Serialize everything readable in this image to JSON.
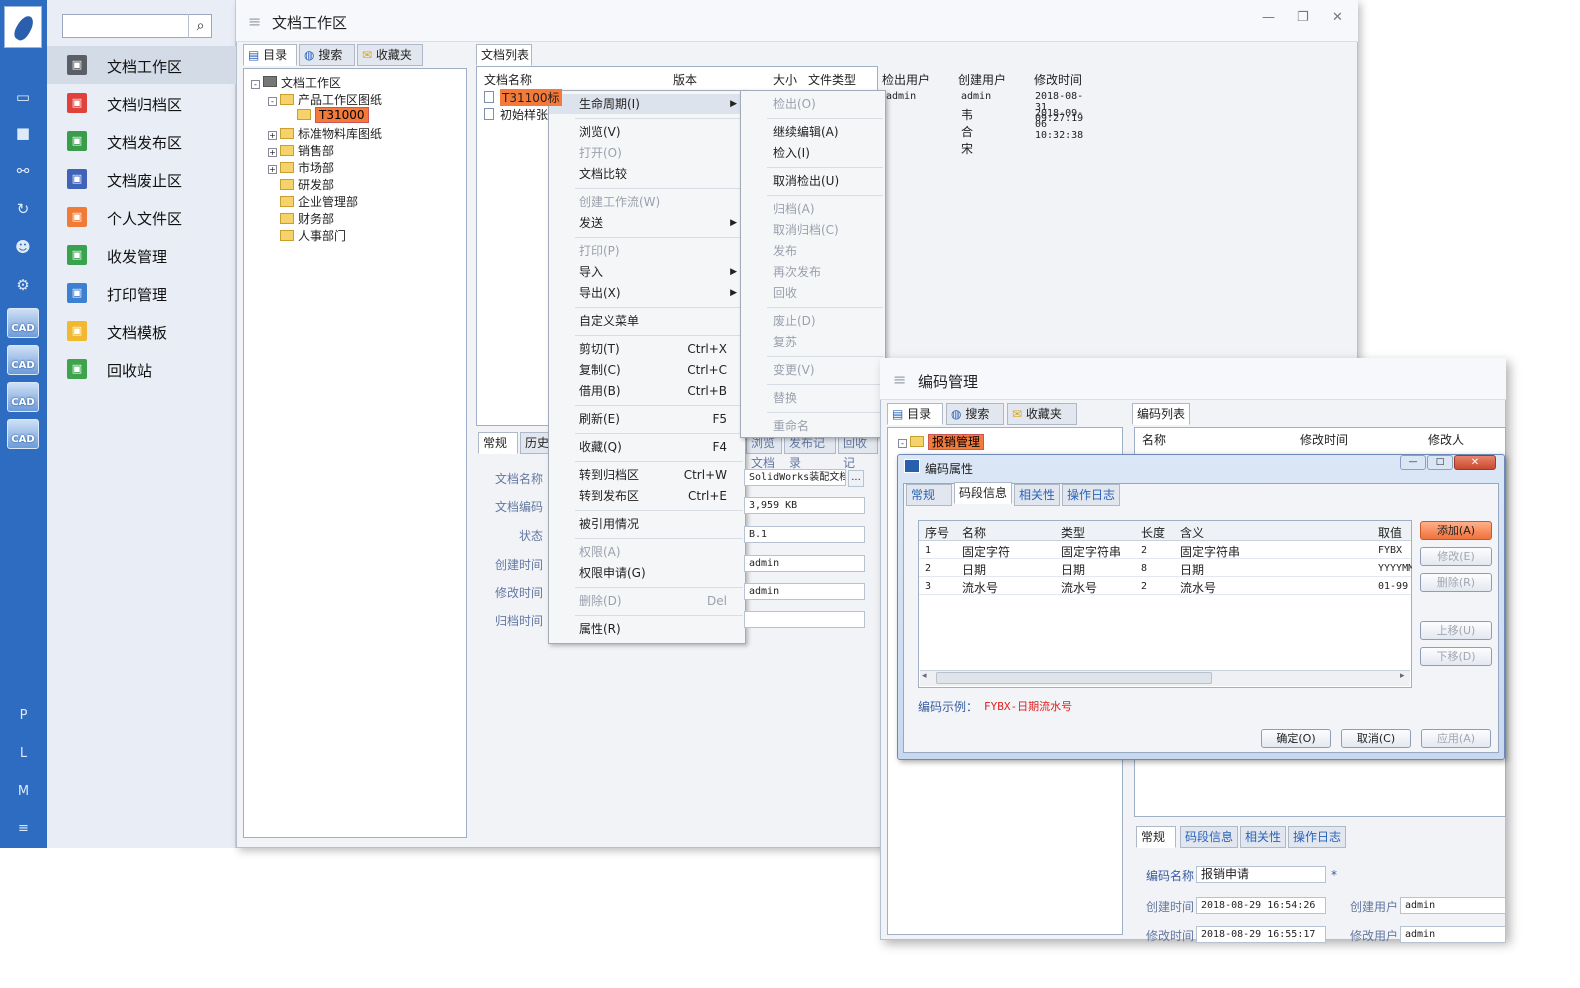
{
  "rail": {
    "letters": [
      "P",
      "L",
      "M",
      "≡"
    ],
    "cad_label": "CAD"
  },
  "nav": {
    "items": [
      {
        "label": "文档工作区",
        "color": "#5a5f66"
      },
      {
        "label": "文档归档区",
        "color": "#e0413a"
      },
      {
        "label": "文档发布区",
        "color": "#3a9d4a"
      },
      {
        "label": "文档废止区",
        "color": "#3f63b8"
      },
      {
        "label": "个人文件区",
        "color": "#f07b36"
      },
      {
        "label": "收发管理",
        "color": "#39a24e"
      },
      {
        "label": "打印管理",
        "color": "#3d7fd1"
      },
      {
        "label": "文档模板",
        "color": "#f2b830"
      },
      {
        "label": "回收站",
        "color": "#3ea34c"
      }
    ]
  },
  "main": {
    "title": "文档工作区",
    "tree_tabs": [
      "目录",
      "搜索",
      "收藏夹"
    ],
    "tree": [
      {
        "label": "文档工作区",
        "level": 0,
        "pm": "-"
      },
      {
        "label": "产品工作区图纸",
        "level": 1,
        "pm": "-"
      },
      {
        "label": "T31000",
        "level": 2,
        "pm": ""
      },
      {
        "label": "标准物料库图纸",
        "level": 1,
        "pm": "+"
      },
      {
        "label": "销售部",
        "level": 1,
        "pm": "+"
      },
      {
        "label": "市场部",
        "level": 1,
        "pm": "+"
      },
      {
        "label": "研发部",
        "level": 1,
        "pm": ""
      },
      {
        "label": "企业管理部",
        "level": 1,
        "pm": ""
      },
      {
        "label": "财务部",
        "level": 1,
        "pm": ""
      },
      {
        "label": "人事部门",
        "level": 1,
        "pm": ""
      }
    ],
    "list_tab": "文档列表",
    "columns": [
      "文档名称",
      "版本",
      "大小",
      "文件类型",
      "检出用户",
      "创建用户",
      "修改时间"
    ],
    "rows": [
      {
        "name": "T31100标",
        "checkout": "admin",
        "creator": "admin",
        "modified": "2018-08-31 09:27:19"
      },
      {
        "name": "初始样张",
        "checkout": "",
        "creator": "韦合宋",
        "modified": "2018-09-06 10:32:38"
      }
    ],
    "bottom_tabs": [
      "常规",
      "历史"
    ],
    "bottom_tabs_right": [
      "浏览文档",
      "发布记录",
      "回收记"
    ],
    "props": [
      {
        "label": "文档名称",
        "value": "SolidWorks装配文档"
      },
      {
        "label": "文档编码",
        "value": "3,959 KB"
      },
      {
        "label": "状态",
        "value": "B.1"
      },
      {
        "label": "创建时间",
        "value": "admin"
      },
      {
        "label": "修改时间",
        "value": "admin"
      },
      {
        "label": "归档时间",
        "value": ""
      }
    ],
    "props_browse": "..."
  },
  "context_menu": {
    "items": [
      {
        "label": "生命周期(I)",
        "shortcut": "",
        "arrow": true,
        "disabled": false,
        "hover": true
      },
      {
        "label": "浏览(V)",
        "shortcut": "",
        "arrow": false,
        "disabled": false
      },
      {
        "label": "打开(O)",
        "shortcut": "",
        "arrow": false,
        "disabled": true
      },
      {
        "label": "文档比较",
        "shortcut": "",
        "arrow": false,
        "disabled": false
      },
      {
        "label": "创建工作流(W)",
        "shortcut": "",
        "arrow": false,
        "disabled": true
      },
      {
        "label": "发送",
        "shortcut": "",
        "arrow": true,
        "disabled": false
      },
      {
        "label": "打印(P)",
        "shortcut": "",
        "arrow": false,
        "disabled": true
      },
      {
        "label": "导入",
        "shortcut": "",
        "arrow": true,
        "disabled": false
      },
      {
        "label": "导出(X)",
        "shortcut": "",
        "arrow": true,
        "disabled": false
      },
      {
        "label": "自定义菜单",
        "shortcut": "",
        "arrow": false,
        "disabled": false
      },
      {
        "label": "剪切(T)",
        "shortcut": "Ctrl+X",
        "arrow": false,
        "disabled": false
      },
      {
        "label": "复制(C)",
        "shortcut": "Ctrl+C",
        "arrow": false,
        "disabled": false
      },
      {
        "label": "借用(B)",
        "shortcut": "Ctrl+B",
        "arrow": false,
        "disabled": false
      },
      {
        "label": "刷新(E)",
        "shortcut": "F5",
        "arrow": false,
        "disabled": false
      },
      {
        "label": "收藏(Q)",
        "shortcut": "F4",
        "arrow": false,
        "disabled": false
      },
      {
        "label": "转到归档区",
        "shortcut": "Ctrl+W",
        "arrow": false,
        "disabled": false
      },
      {
        "label": "转到发布区",
        "shortcut": "Ctrl+E",
        "arrow": false,
        "disabled": false
      },
      {
        "label": "被引用情况",
        "shortcut": "",
        "arrow": false,
        "disabled": false
      },
      {
        "label": "权限(A)",
        "shortcut": "",
        "arrow": false,
        "disabled": true
      },
      {
        "label": "权限申请(G)",
        "shortcut": "",
        "arrow": false,
        "disabled": false
      },
      {
        "label": "删除(D)",
        "shortcut": "Del",
        "arrow": false,
        "disabled": true
      },
      {
        "label": "属性(R)",
        "shortcut": "",
        "arrow": false,
        "disabled": false
      }
    ]
  },
  "submenu": {
    "items": [
      {
        "label": "检出(O)",
        "disabled": true
      },
      {
        "label": "继续编辑(A)",
        "disabled": false
      },
      {
        "label": "检入(I)",
        "disabled": false
      },
      {
        "label": "取消检出(U)",
        "disabled": false
      },
      {
        "label": "归档(A)",
        "disabled": true
      },
      {
        "label": "取消归档(C)",
        "disabled": true
      },
      {
        "label": "发布",
        "disabled": true
      },
      {
        "label": "再次发布",
        "disabled": true
      },
      {
        "label": "回收",
        "disabled": true
      },
      {
        "label": "废止(D)",
        "disabled": true
      },
      {
        "label": "复苏",
        "disabled": true
      },
      {
        "label": "变更(V)",
        "disabled": true
      },
      {
        "label": "替换",
        "disabled": true
      },
      {
        "label": "重命名",
        "disabled": true
      }
    ]
  },
  "code_win": {
    "title": "编码管理",
    "tree_tabs": [
      "目录",
      "搜索",
      "收藏夹"
    ],
    "tree_root": "报销管理",
    "list_tab": "编码列表",
    "columns": [
      "名称",
      "修改时间",
      "修改人"
    ],
    "bottom_tabs": [
      "常规",
      "码段信息",
      "相关性",
      "操作日志"
    ],
    "props": {
      "name_label": "编码名称",
      "name_value": "报销申请",
      "required_mark": "*",
      "created_label": "创建时间",
      "created_value": "2018-08-29 16:54:26",
      "creator_label": "创建用户",
      "creator_value": "admin",
      "modified_label": "修改时间",
      "modified_value": "2018-08-29 16:55:17",
      "modifier_label": "修改用户",
      "modifier_value": "admin"
    }
  },
  "dialog": {
    "title": "编码属性",
    "tabs": [
      "常规",
      "码段信息",
      "相关性",
      "操作日志"
    ],
    "columns": [
      "序号",
      "名称",
      "类型",
      "长度",
      "含义",
      "取值"
    ],
    "rows": [
      [
        "1",
        "固定字符",
        "固定字符串",
        "2",
        "固定字符串",
        "FYBX"
      ],
      [
        "2",
        "日期",
        "日期",
        "8",
        "日期",
        "YYYYMM"
      ],
      [
        "3",
        "流水号",
        "流水号",
        "2",
        "流水号",
        "01-99"
      ]
    ],
    "side_buttons": [
      "添加(A)",
      "修改(E)",
      "删除(R)",
      "上移(U)",
      "下移(D)"
    ],
    "example_label": "编码示例：",
    "example_value": "FYBX-日期流水号",
    "buttons": [
      "确定(O)",
      "取消(C)",
      "应用(A)"
    ]
  }
}
